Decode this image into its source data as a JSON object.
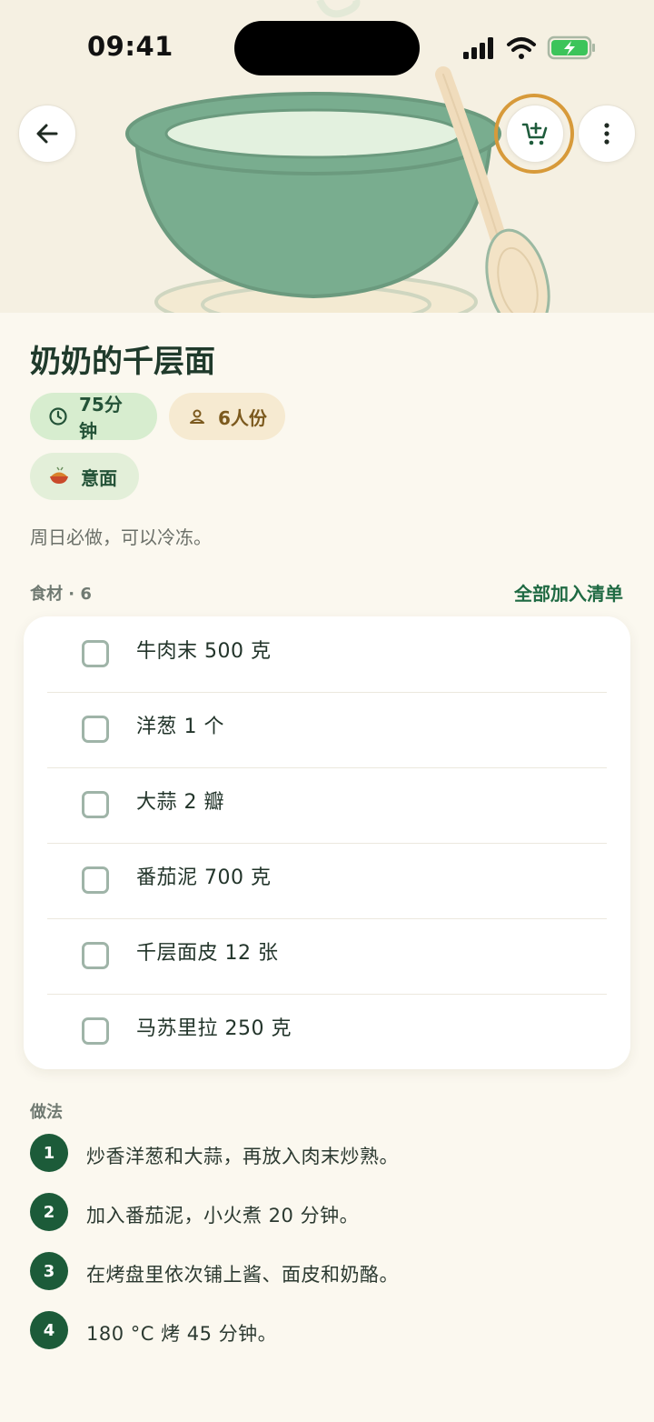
{
  "status_bar": {
    "time": "09:41"
  },
  "recipe": {
    "title": "奶奶的千层面",
    "time_chip": "75分钟",
    "servings_chip": "6人份",
    "category_chip": "意面",
    "description": "周日必做，可以冷冻。"
  },
  "ingredients": {
    "label": "食材 · 6",
    "add_all": "全部加入清单",
    "items": [
      "牛肉末 500 克",
      "洋葱 1 个",
      "大蒜 2 瓣",
      "番茄泥 700 克",
      "千层面皮 12 张",
      "马苏里拉 250 克"
    ]
  },
  "method": {
    "label": "做法",
    "steps": [
      {
        "num": "1",
        "text": "炒香洋葱和大蒜，再放入肉末炒熟。"
      },
      {
        "num": "2",
        "text": "加入番茄泥，小火煮 20 分钟。"
      },
      {
        "num": "3",
        "text": "在烤盘里依次铺上酱、面皮和奶酪。"
      },
      {
        "num": "4",
        "text": "180 °C 烤 45 分钟。"
      }
    ]
  },
  "icons": {
    "back": "arrow-left-icon",
    "cart": "cart-plus-icon",
    "more": "more-vertical-icon",
    "clock": "clock-icon",
    "person": "person-icon",
    "pasta": "pasta-bowl-icon"
  },
  "colors": {
    "accent": "#1c5b39",
    "highlight": "#d79a3a",
    "background": "#fbf8ef"
  }
}
